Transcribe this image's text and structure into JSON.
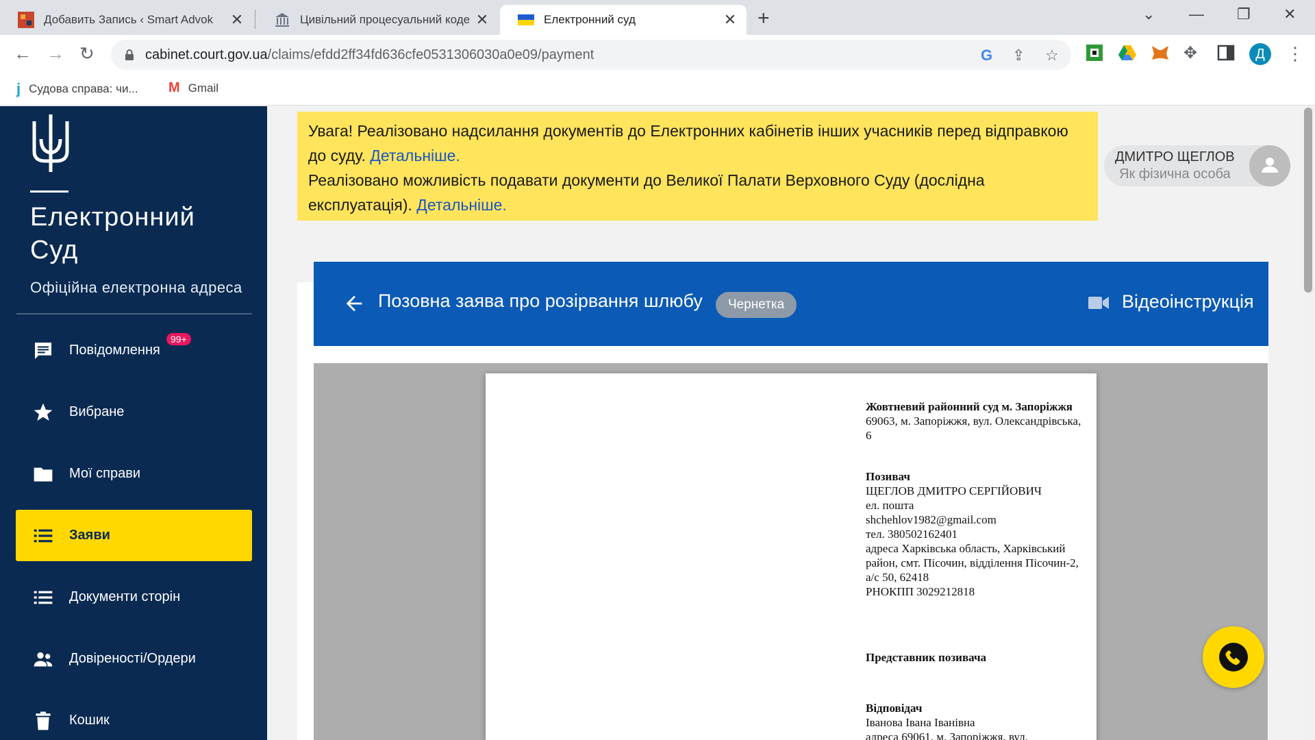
{
  "browser": {
    "tabs": [
      {
        "title": "Добавить Запись ‹ Smart Advok",
        "close": "✕"
      },
      {
        "title": "Цивільний процесуальний коде",
        "close": "✕"
      },
      {
        "title": "Електронний суд",
        "close": "✕"
      }
    ],
    "new_tab": "+",
    "window_controls": {
      "minimize": "—",
      "restore": "❐",
      "close": "✕",
      "dropdown": "⌄"
    },
    "url_host": "cabinet.court.gov.ua",
    "url_path": "/claims/efdd2ff34fd636cfe0531306030a0e09/payment",
    "profile_initial": "Д",
    "bookmarks": [
      {
        "label": "Судова справа: чи...",
        "icon": "j"
      },
      {
        "label": "Gmail",
        "icon": "M"
      }
    ]
  },
  "sidebar": {
    "brand_line1": "Електронний",
    "brand_line2": "Суд",
    "subtitle": "Офіційна електронна адреса",
    "items": [
      {
        "label": "Повідомлення",
        "icon": "message-icon",
        "badge": "99+"
      },
      {
        "label": "Вибране",
        "icon": "star-icon"
      },
      {
        "label": "Мої справи",
        "icon": "folder-icon"
      },
      {
        "label": "Заяви",
        "icon": "list-icon",
        "active": true
      },
      {
        "label": "Документи сторін",
        "icon": "list-icon"
      },
      {
        "label": "Довіреності/Ордери",
        "icon": "people-icon"
      },
      {
        "label": "Кошик",
        "icon": "trash-icon"
      }
    ]
  },
  "notice": {
    "line1": "Увага! Реалізовано надсилання документів до Електронних кабінетів інших учасників перед відправкою до суду.",
    "link1": "Детальніше.",
    "line2": "Реалізовано можливість подавати документи до Великої Палати Верховного Суду (дослідна експлуатація).",
    "link2": "Детальніше."
  },
  "user": {
    "name": "ДМИТРО ЩЕГЛОВ",
    "role": "Як фізична особа"
  },
  "claim": {
    "title": "Позовна заява про розірвання шлюбу",
    "status": "Чернетка",
    "video_label": "Відеоінструкція"
  },
  "document": {
    "court_name": "Жовтневий районний суд м. Запоріжжя",
    "court_address": "69063, м. Запоріжжя, вул. Олександрівська, 6",
    "plaintiff_heading": "Позивач",
    "plaintiff_name": "ЩЕГЛОВ ДМИТРО СЕРГІЙОВИЧ",
    "plaintiff_email_label": "ел. пошта",
    "plaintiff_email": "shchehlov1982@gmail.com",
    "plaintiff_phone": "тел. 380502162401",
    "plaintiff_address": "адреса Харківська область, Харківський район, смт. Пісочин, відділення Пісочин-2, а/с 50, 62418",
    "plaintiff_rnokpp": "РНОКПП 3029212818",
    "representative_heading": "Представник позивача",
    "defendant_heading": "Відповідач",
    "defendant_name": "Іванова Івана Іванівна",
    "defendant_address": "адреса 69061, м. Запоріжжя, вул."
  },
  "colors": {
    "sidebar_bg": "#0a2a52",
    "accent_yellow": "#ffd800",
    "header_blue": "#0b5ab5",
    "notice_bg": "#ffe45c",
    "link": "#1a56c4"
  }
}
